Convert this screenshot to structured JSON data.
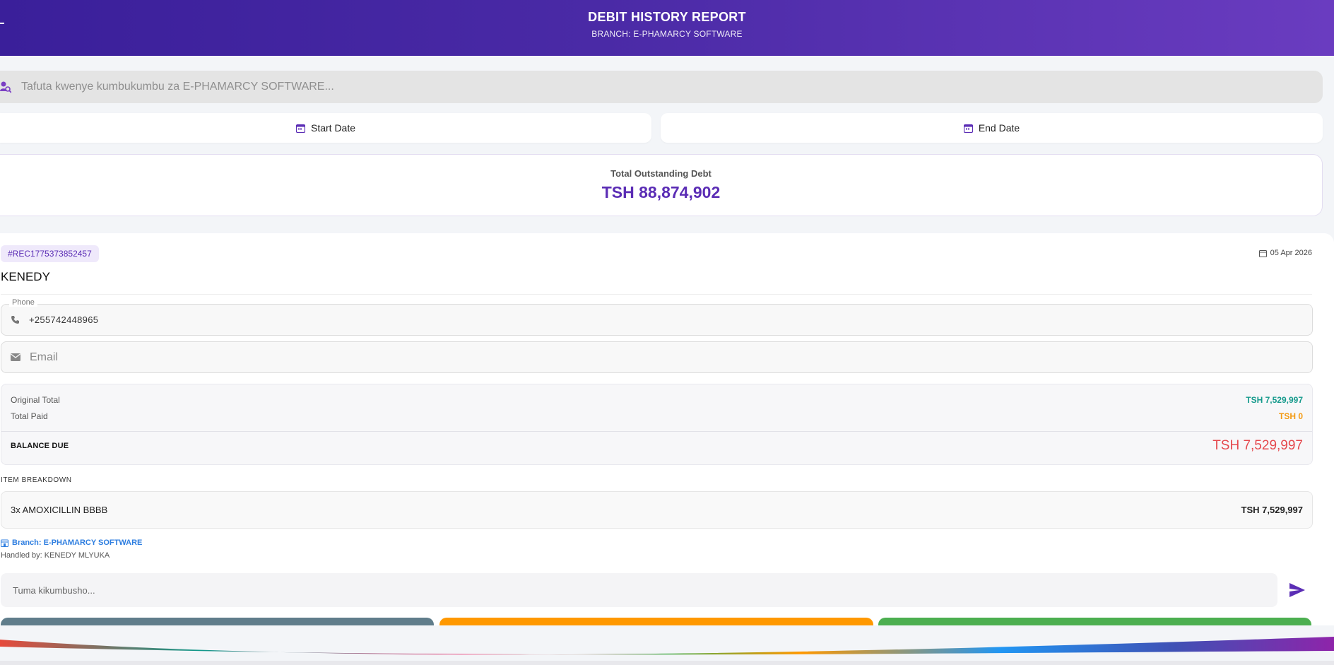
{
  "header": {
    "title": "DEBIT HISTORY REPORT",
    "subtitle": "BRANCH: E-PHAMARCY SOFTWARE"
  },
  "search": {
    "placeholder": "Tafuta kwenye kumbukumbu za E-PHAMARCY SOFTWARE..."
  },
  "filters": {
    "start_label": "Start Date",
    "end_label": "End Date"
  },
  "summary_card": {
    "label": "Total Outstanding Debt",
    "value": "TSH 88,874,902"
  },
  "record": {
    "ref": "#REC1775373852457",
    "date": "05 Apr 2026",
    "customer": "KENEDY",
    "phone_label": "Phone",
    "phone": "+255742448965",
    "email_placeholder": "Email",
    "original_total_label": "Original Total",
    "original_total": "TSH 7,529,997",
    "total_paid_label": "Total Paid",
    "total_paid": "TSH 0",
    "balance_label": "BALANCE DUE",
    "balance": "TSH 7,529,997",
    "breakdown_label": "ITEM BREAKDOWN",
    "items": [
      {
        "name": "3x AMOXICILLIN BBBB",
        "price": "TSH 7,529,997"
      }
    ],
    "branch": "Branch: E-PHAMARCY SOFTWARE",
    "handled_by": "Handled by: KENEDY MLYUKA",
    "reminder_placeholder": "Tuma kikumbusho..."
  },
  "colors": {
    "primary": "#5b2db5",
    "paid": "#f39a12",
    "original": "#159a8c",
    "balance": "#e5484d",
    "branch": "#2e7ee0"
  },
  "icons": [
    "menu-icon",
    "search-user-icon",
    "calendar-icon",
    "phone-icon",
    "email-icon",
    "store-icon",
    "send-icon"
  ]
}
